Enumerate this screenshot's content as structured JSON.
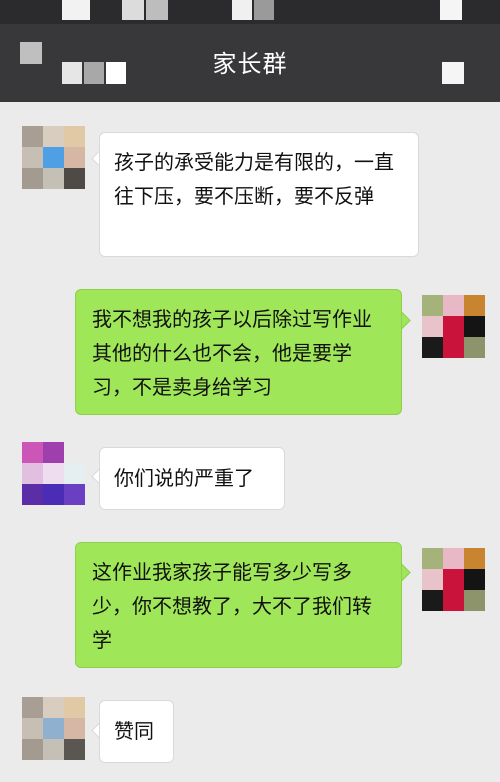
{
  "header": {
    "title": "家长群"
  },
  "messages": [
    {
      "side": "in",
      "text": "孩子的承受能力是有限的，一直往下压，要不压断，要不反弹"
    },
    {
      "side": "out",
      "text": "我不想我的孩子以后除过写作业其他的什么也不会，他是要学习，不是卖身给学习"
    },
    {
      "side": "in",
      "text": "你们说的严重了"
    },
    {
      "side": "out",
      "text": "这作业我家孩子能写多少写多少，你不想教了，大不了我们转学"
    },
    {
      "side": "in",
      "text": "赞同"
    }
  ],
  "colors": {
    "status_bar": "#2b2b2d",
    "nav_bar": "#38383a",
    "chat_background": "#ebebeb",
    "incoming_bubble": "#ffffff",
    "outgoing_bubble": "#9fe658"
  },
  "icons": {
    "back": "blurred-back-icon",
    "more": "blurred-more-icon"
  }
}
